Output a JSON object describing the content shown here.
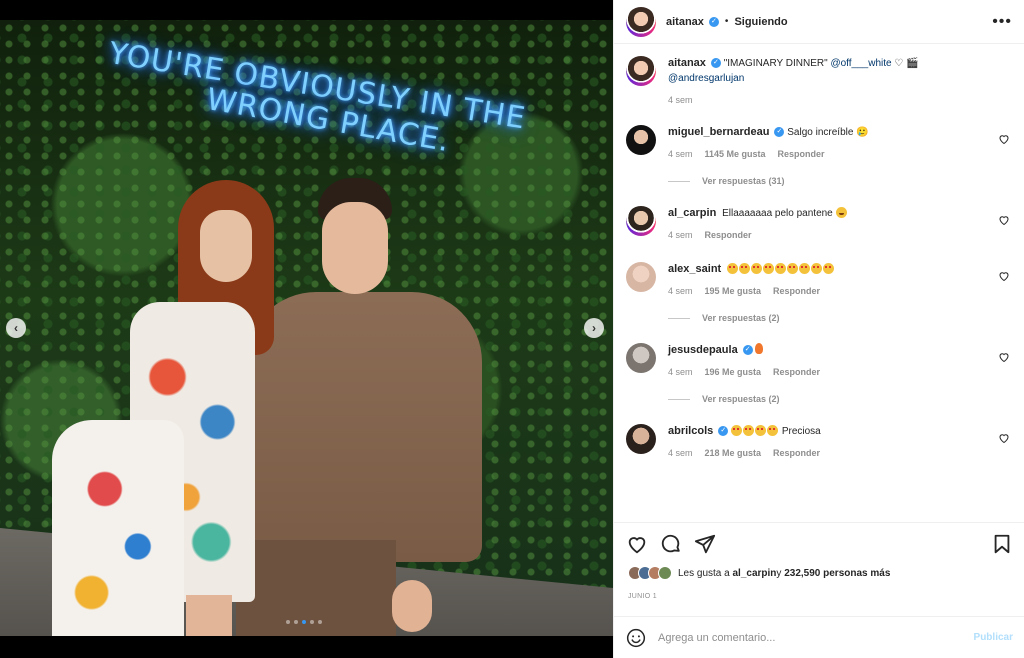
{
  "post": {
    "neon_line1": "YOU'RE OBVIOUSLY IN THE",
    "neon_line2": "WRONG PLACE.",
    "carousel_prev": "‹",
    "carousel_next": "›"
  },
  "header": {
    "username": "aitanax",
    "verified": "✓",
    "separator": "•",
    "follow_status": "Siguiendo",
    "more": "•••"
  },
  "caption": {
    "username": "aitanax",
    "text_before": " \"IMAGINARY DINNER\" ",
    "mention1": "@off___white",
    "text_after": " ♡ 🎬 ",
    "mention2": "@andresgarlujan",
    "time": "4 sem"
  },
  "comments": [
    {
      "username": "miguel_bernardeau",
      "verified": true,
      "text": "Salgo increíble 🥲",
      "time": "4 sem",
      "likes": "1145 Me gusta",
      "reply": "Responder",
      "replies": "Ver respuestas (31)"
    },
    {
      "username": "al_carpin",
      "verified": false,
      "text": "Ellaaaaaaa pelo pantene",
      "time": "4 sem",
      "likes": "",
      "reply": "Responder",
      "replies": ""
    },
    {
      "username": "alex_saint",
      "verified": false,
      "text": "",
      "time": "4 sem",
      "likes": "195 Me gusta",
      "reply": "Responder",
      "replies": "Ver respuestas (2)"
    },
    {
      "username": "jesusdepaula",
      "verified": true,
      "text": "",
      "time": "4 sem",
      "likes": "196 Me gusta",
      "reply": "Responder",
      "replies": "Ver respuestas (2)"
    },
    {
      "username": "abrilcols",
      "verified": true,
      "text": "Preciosa",
      "time": "4 sem",
      "likes": "218 Me gusta",
      "reply": "Responder",
      "replies": ""
    }
  ],
  "likes": {
    "prefix": "Les gusta a ",
    "user": "al_carpin",
    "middle": " y ",
    "count": "232,590 personas más"
  },
  "date": "JUNIO 1",
  "add_comment": {
    "placeholder": "Agrega un comentario...",
    "publish": "Publicar"
  },
  "colors": {
    "link": "#00376b",
    "verified": "#3897f0",
    "muted": "#8e8e8e"
  }
}
